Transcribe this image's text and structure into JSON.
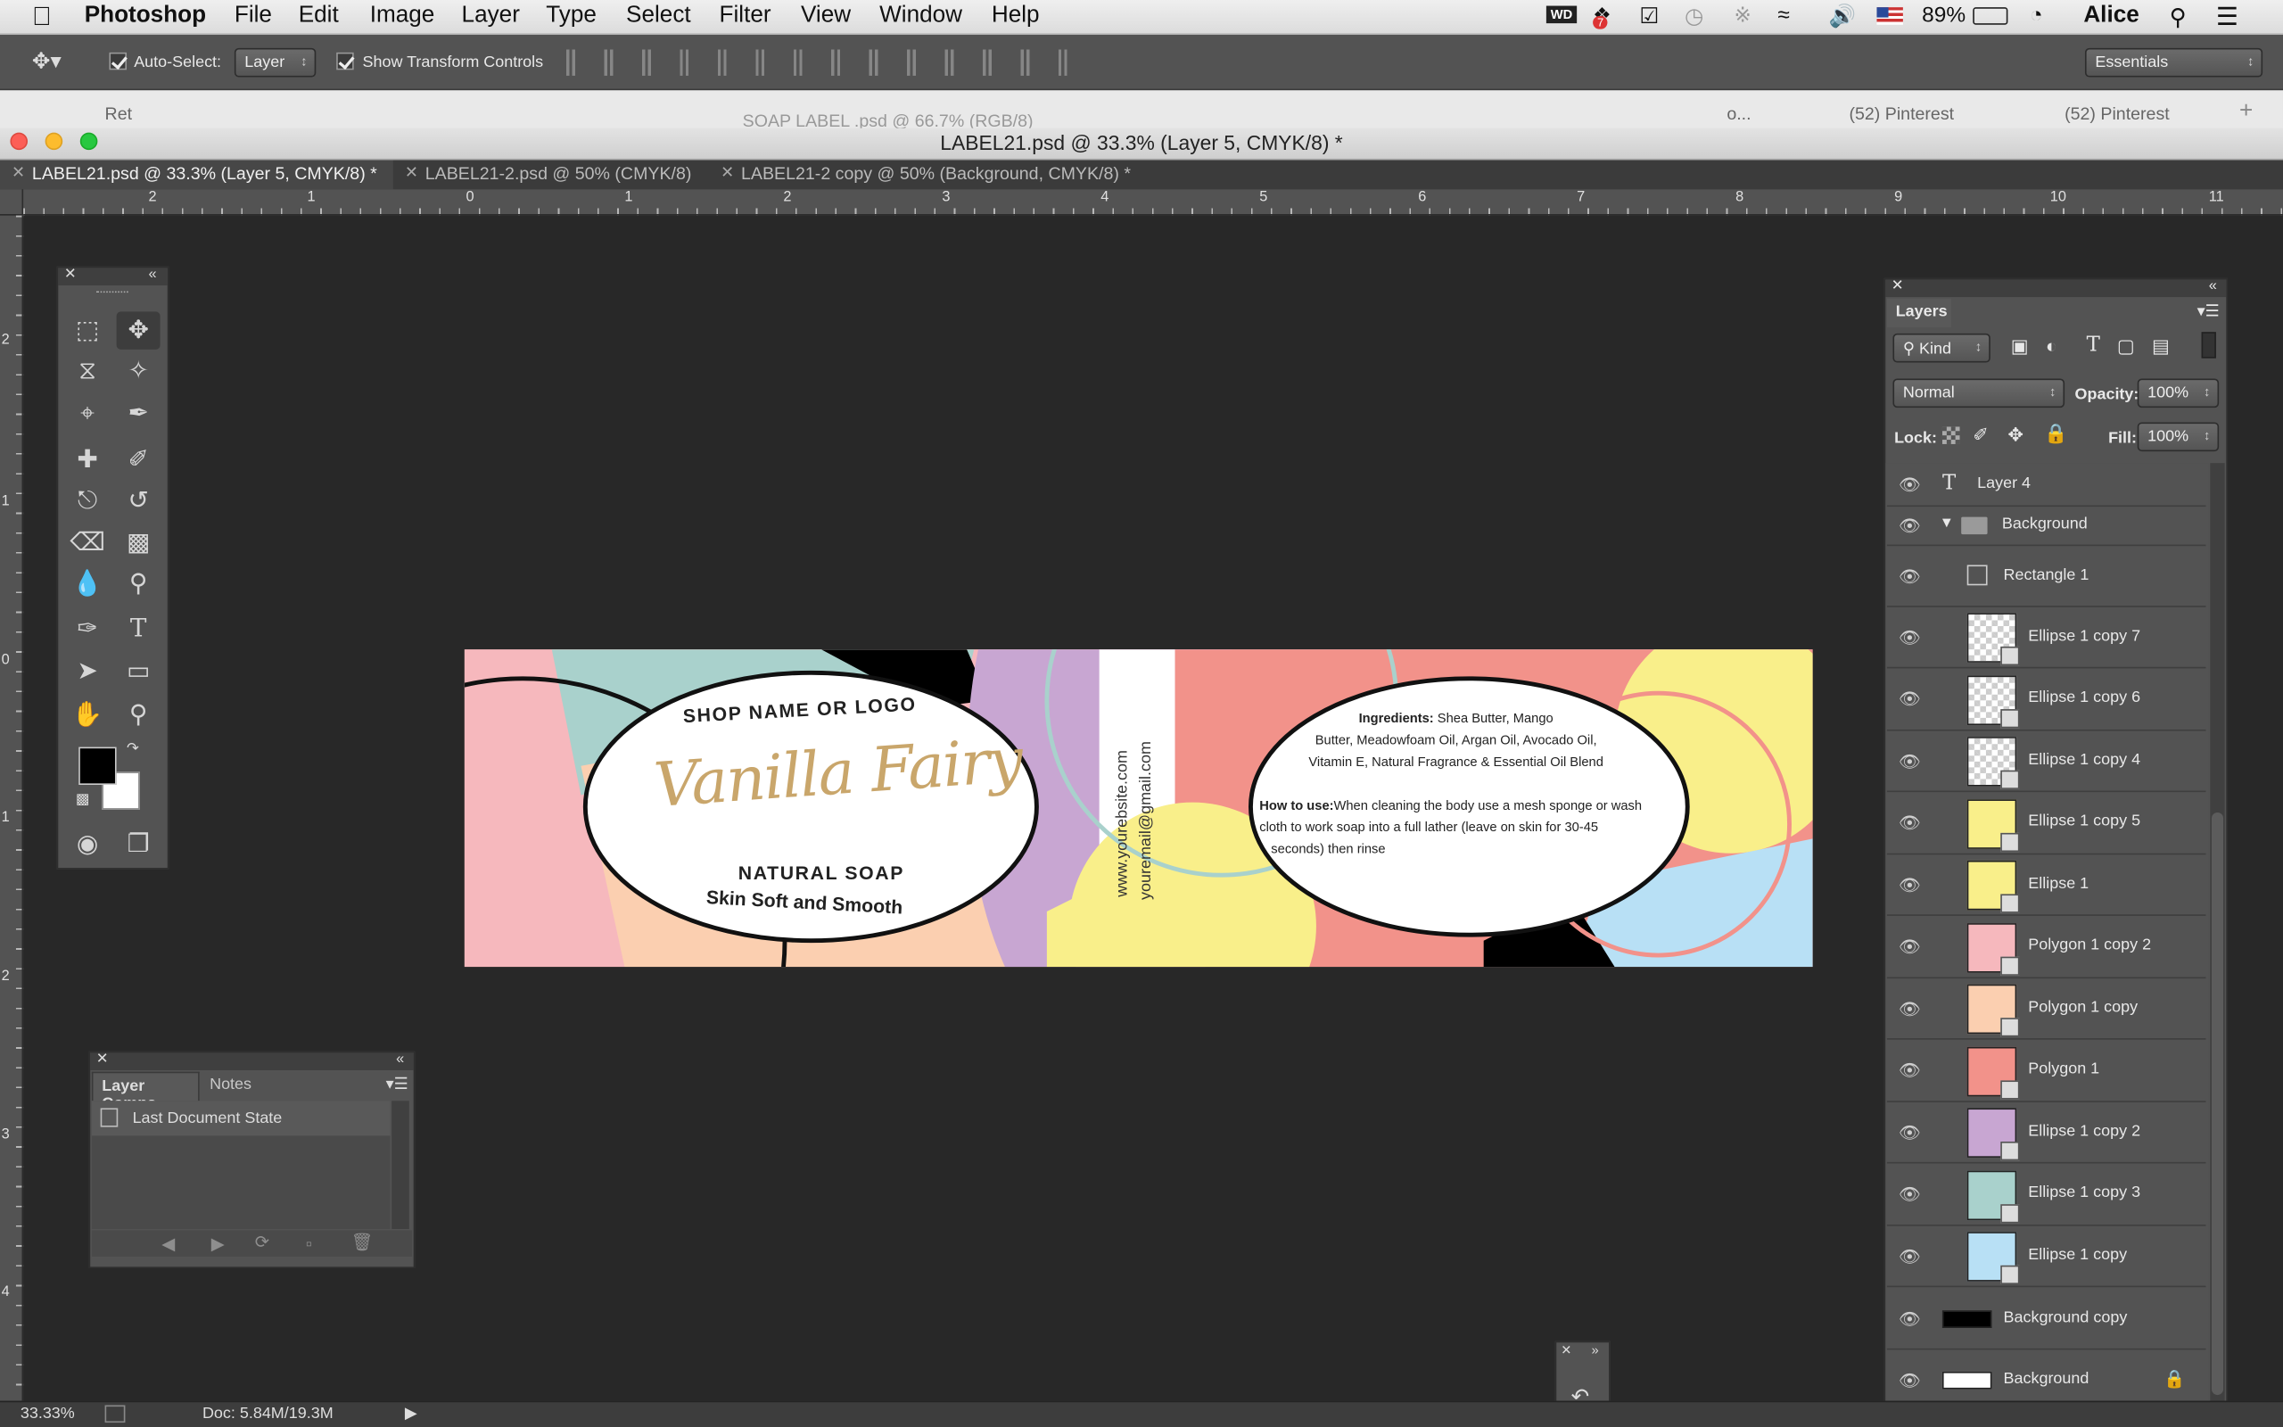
{
  "menubar": {
    "app": "Photoshop",
    "items": [
      "File",
      "Edit",
      "Image",
      "Layer",
      "Type",
      "Select",
      "Filter",
      "View",
      "Window",
      "Help"
    ],
    "battery": "89%",
    "user": "Alice",
    "notif_badge": "7"
  },
  "options": {
    "auto_select_label": "Auto-Select:",
    "auto_select_value": "Layer",
    "transform_label": "Show Transform Controls",
    "workspace": "Essentials"
  },
  "browser": {
    "tab1": "Ret",
    "center": "SOAP LABEL .psd @ 66.7% (RGB/8)",
    "dots": "o...",
    "tab2": "(52) Pinterest",
    "tab3": "(52) Pinterest",
    "plus": "+"
  },
  "document": {
    "title": "LABEL21.psd @ 33.3% (Layer 5, CMYK/8) *",
    "tabs": [
      "LABEL21.psd @ 33.3% (Layer 5, CMYK/8) *",
      "LABEL21-2.psd @ 50% (CMYK/8)",
      "LABEL21-2 copy @ 50% (Background, CMYK/8) *"
    ]
  },
  "ruler": {
    "h": [
      "2",
      "1",
      "0",
      "1",
      "2",
      "3",
      "4",
      "5",
      "6",
      "7",
      "8",
      "9",
      "10",
      "11"
    ],
    "v": [
      "2",
      "1",
      "0",
      "1",
      "2",
      "3",
      "4"
    ]
  },
  "label_art": {
    "shop": "SHOP NAME OR LOGO",
    "brand": "Vanilla Fairy",
    "natural": "NATURAL SOAP",
    "tagline": "Skin Soft and Smooth",
    "website": "www.yourebsite.com",
    "email": "youremail@gmail.com",
    "ingredients_label": "Ingredients:",
    "ingredients_text1": "Shea Butter, Mango",
    "ingredients_text2": "Butter, Meadowfoam Oil, Argan Oil, Avocado Oil,",
    "ingredients_text3": "Vitamin E, Natural Fragrance & Essential Oil Blend",
    "howto_label": "How to use:",
    "howto_text1": "When cleaning the body use a mesh sponge or wash",
    "howto_text2": "cloth to work soap into a full lather (leave on skin for 30-45",
    "howto_text3": "seconds) then rinse",
    "colors": {
      "pink": "#f6b8bd",
      "mint": "#a9d1cc",
      "peach": "#fbcfb0",
      "lilac": "#c8a6d2",
      "coral": "#f2928a",
      "yellow": "#f9ef8a",
      "blue": "#b8e0f5",
      "black": "#000000"
    }
  },
  "layer_comps": {
    "tabs": [
      "Layer Comps",
      "Notes"
    ],
    "item": "Last Document State"
  },
  "layers": {
    "title": "Layers",
    "filter": "Kind",
    "blend": "Normal",
    "opacity_label": "Opacity:",
    "opacity": "100%",
    "lock_label": "Lock:",
    "fill_label": "Fill:",
    "fill": "100%",
    "rows": [
      {
        "name": "Layer 4",
        "kind": "text"
      },
      {
        "name": "Background",
        "kind": "group"
      },
      {
        "name": "Rectangle 1",
        "kind": "shape"
      },
      {
        "name": "Ellipse 1 copy 7",
        "kind": "thumb",
        "color": "checker"
      },
      {
        "name": "Ellipse 1 copy 6",
        "kind": "thumb",
        "color": "checker"
      },
      {
        "name": "Ellipse 1 copy 4",
        "kind": "thumb",
        "color": "checker"
      },
      {
        "name": "Ellipse 1 copy 5",
        "kind": "thumb",
        "color": "#f9ef8a"
      },
      {
        "name": "Ellipse 1",
        "kind": "thumb",
        "color": "#f9ef8a"
      },
      {
        "name": "Polygon 1 copy 2",
        "kind": "thumb",
        "color": "#f6b8bd"
      },
      {
        "name": "Polygon 1 copy",
        "kind": "thumb",
        "color": "#fbcfb0"
      },
      {
        "name": "Polygon 1",
        "kind": "thumb",
        "color": "#f2928a"
      },
      {
        "name": "Ellipse 1 copy 2",
        "kind": "thumb",
        "color": "#c8a6d2"
      },
      {
        "name": "Ellipse 1 copy 3",
        "kind": "thumb",
        "color": "#a9d1cc"
      },
      {
        "name": "Ellipse 1 copy",
        "kind": "thumb",
        "color": "#b8e0f5"
      },
      {
        "name": "Background copy",
        "kind": "fill",
        "color": "#000000"
      },
      {
        "name": "Background",
        "kind": "fill",
        "color": "#ffffff"
      }
    ]
  },
  "status": {
    "zoom": "33.33%",
    "doc": "Doc: 5.84M/19.3M"
  }
}
